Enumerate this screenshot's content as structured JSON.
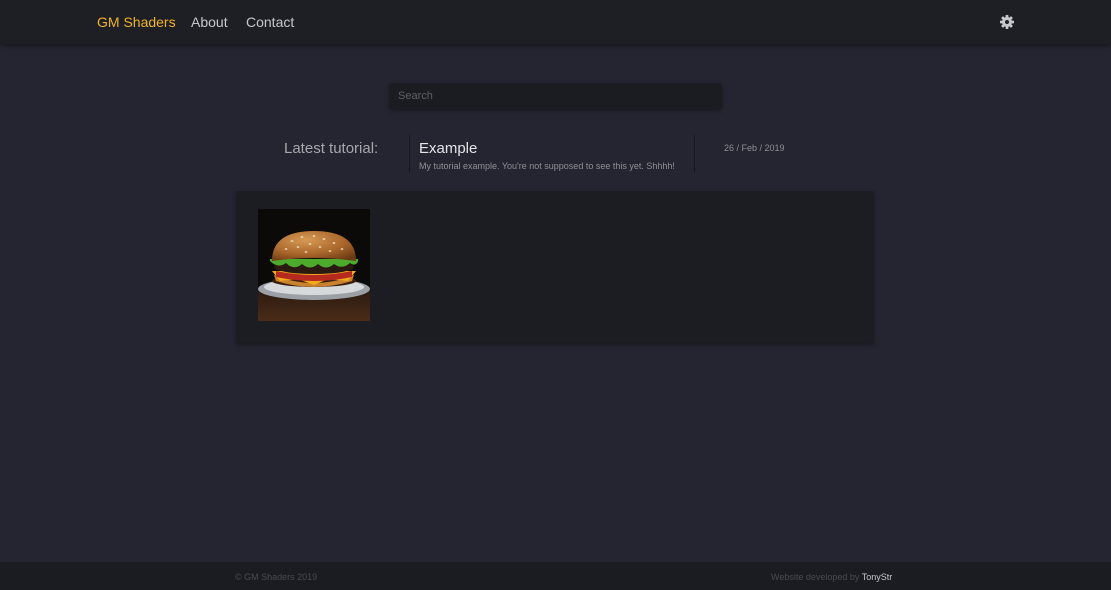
{
  "nav": {
    "brand": "GM Shaders",
    "links": [
      "About",
      "Contact"
    ],
    "settings_icon": "gear-icon"
  },
  "search": {
    "placeholder": "Search",
    "value": ""
  },
  "latest": {
    "label": "Latest tutorial:",
    "title": "Example",
    "description": "My tutorial example. You're not supposed to see this yet. Shhhh!",
    "date": "26 / Feb / 2019"
  },
  "gallery": {
    "items": [
      {
        "image": "burger-thumbnail"
      }
    ]
  },
  "footer": {
    "copyright": "© GM Shaders 2019",
    "credit_prefix": "Website developed by ",
    "credit_author": "TonyStr"
  },
  "colors": {
    "background": "#242530",
    "navbar": "#1e1f25",
    "accent": "#f0b428",
    "panel": "#1c1d22"
  }
}
